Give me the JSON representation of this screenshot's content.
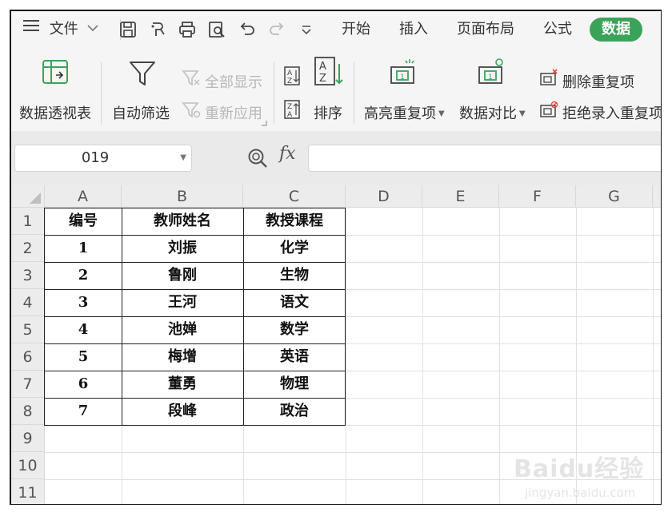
{
  "menu": {
    "hamburger_label": "文件",
    "tabs": [
      "开始",
      "插入",
      "页面布局",
      "公式"
    ],
    "active_tab": "数据"
  },
  "ribbon": {
    "pivot_label": "数据透视表",
    "autofilter_label": "自动筛选",
    "show_all_label": "全部显示",
    "reapply_label": "重新应用",
    "sort_label": "排序",
    "highlight_dup_label": "高亮重复项",
    "compare_label": "数据对比",
    "remove_dup_label": "删除重复项",
    "reject_dup_label": "拒绝录入重复项"
  },
  "formula_bar": {
    "name_box": "019",
    "fx": "fx"
  },
  "grid": {
    "columns": [
      "A",
      "B",
      "C",
      "D",
      "E",
      "F",
      "G"
    ],
    "rows": [
      "1",
      "2",
      "3",
      "4",
      "5",
      "6",
      "7",
      "8",
      "9",
      "10",
      "11",
      "12"
    ],
    "table": [
      [
        "编号",
        "教师姓名",
        "教授课程"
      ],
      [
        "1",
        "刘振",
        "化学"
      ],
      [
        "2",
        "鲁刚",
        "生物"
      ],
      [
        "3",
        "王河",
        "语文"
      ],
      [
        "4",
        "池婵",
        "数学"
      ],
      [
        "5",
        "梅增",
        "英语"
      ],
      [
        "6",
        "董勇",
        "物理"
      ],
      [
        "7",
        "段峰",
        "政治"
      ]
    ]
  },
  "watermark": {
    "logo": "Baidu经验",
    "site": "jingyan.baidu.com"
  }
}
